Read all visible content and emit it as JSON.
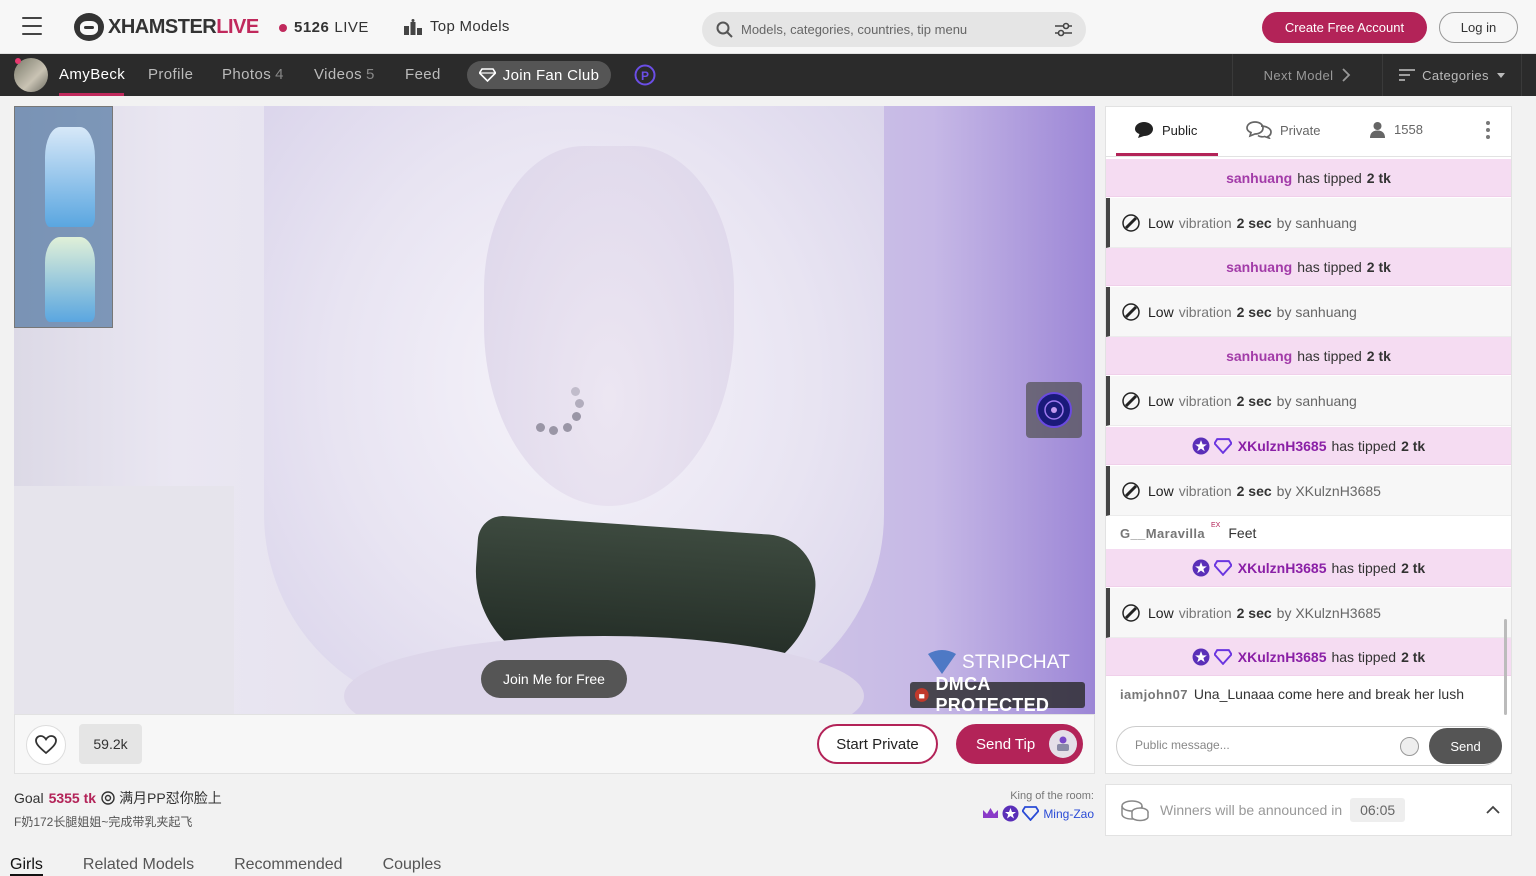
{
  "header": {
    "logo_part1": "XHAMSTER",
    "logo_part2": "LIVE",
    "live_count": "5126",
    "live_label": "LIVE",
    "top_models": "Top Models",
    "search_placeholder": "Models, categories, countries, tip menu",
    "create_account": "Create Free Account",
    "login": "Log in"
  },
  "model_nav": {
    "model_name": "AmyBeck",
    "profile": "Profile",
    "photos": "Photos",
    "photos_count": "4",
    "videos": "Videos",
    "videos_count": "5",
    "feed": "Feed",
    "join_fan_club": "Join Fan Club",
    "next_model": "Next Model",
    "categories": "Categories"
  },
  "video": {
    "join_free": "Join Me for Free",
    "watermark_strip": "STRIPCHAT",
    "watermark_dmca": "DMCA PROTECTED"
  },
  "actions": {
    "likes": "59.2k",
    "start_private": "Start Private",
    "send_tip": "Send Tip"
  },
  "goal": {
    "label": "Goal",
    "amount": "5355 tk",
    "title": "满月PP怼你脸上",
    "subtitle": "F奶172长腿姐姐~完成带乳夹起飞",
    "king_label": "King of the room:",
    "king_name": "Ming-Zao"
  },
  "bottom_tabs": [
    "Girls",
    "Related Models",
    "Recommended",
    "Couples"
  ],
  "chat": {
    "tab_public": "Public",
    "tab_private": "Private",
    "viewers": "1558",
    "messages": [
      {
        "type": "tip",
        "user": "sanhuang",
        "text": "has tipped",
        "amount": "2 tk"
      },
      {
        "type": "vib",
        "level": "Low",
        "word": "vibration",
        "duration": "2 sec",
        "by": "by sanhuang"
      },
      {
        "type": "tip",
        "user": "sanhuang",
        "text": "has tipped",
        "amount": "2 tk"
      },
      {
        "type": "vib",
        "level": "Low",
        "word": "vibration",
        "duration": "2 sec",
        "by": "by sanhuang"
      },
      {
        "type": "tip",
        "user": "sanhuang",
        "text": "has tipped",
        "amount": "2 tk"
      },
      {
        "type": "vib",
        "level": "Low",
        "word": "vibration",
        "duration": "2 sec",
        "by": "by sanhuang"
      },
      {
        "type": "tip2",
        "user": "XKulznH3685",
        "text": "has tipped",
        "amount": "2 tk"
      },
      {
        "type": "vib",
        "level": "Low",
        "word": "vibration",
        "duration": "2 sec",
        "by": "by XKulznH3685"
      },
      {
        "type": "plain",
        "user": "G__Maravilla",
        "badge": "EX",
        "text": "Feet"
      },
      {
        "type": "tip2",
        "user": "XKulznH3685",
        "text": "has tipped",
        "amount": "2 tk"
      },
      {
        "type": "vib",
        "level": "Low",
        "word": "vibration",
        "duration": "2 sec",
        "by": "by XKulznH3685"
      },
      {
        "type": "tip2",
        "user": "XKulznH3685",
        "text": "has tipped",
        "amount": "2 tk"
      },
      {
        "type": "plain",
        "user": "iamjohn07",
        "text": "Una_Lunaaa come here and break her lush"
      }
    ],
    "input_placeholder": "Public message...",
    "send": "Send"
  },
  "winners": {
    "text": "Winners will be announced in",
    "time": "06:05"
  },
  "colors": {
    "accent": "#b32358",
    "tip_bg": "#f5dcf2",
    "dark_bar": "#2b2b2b"
  }
}
